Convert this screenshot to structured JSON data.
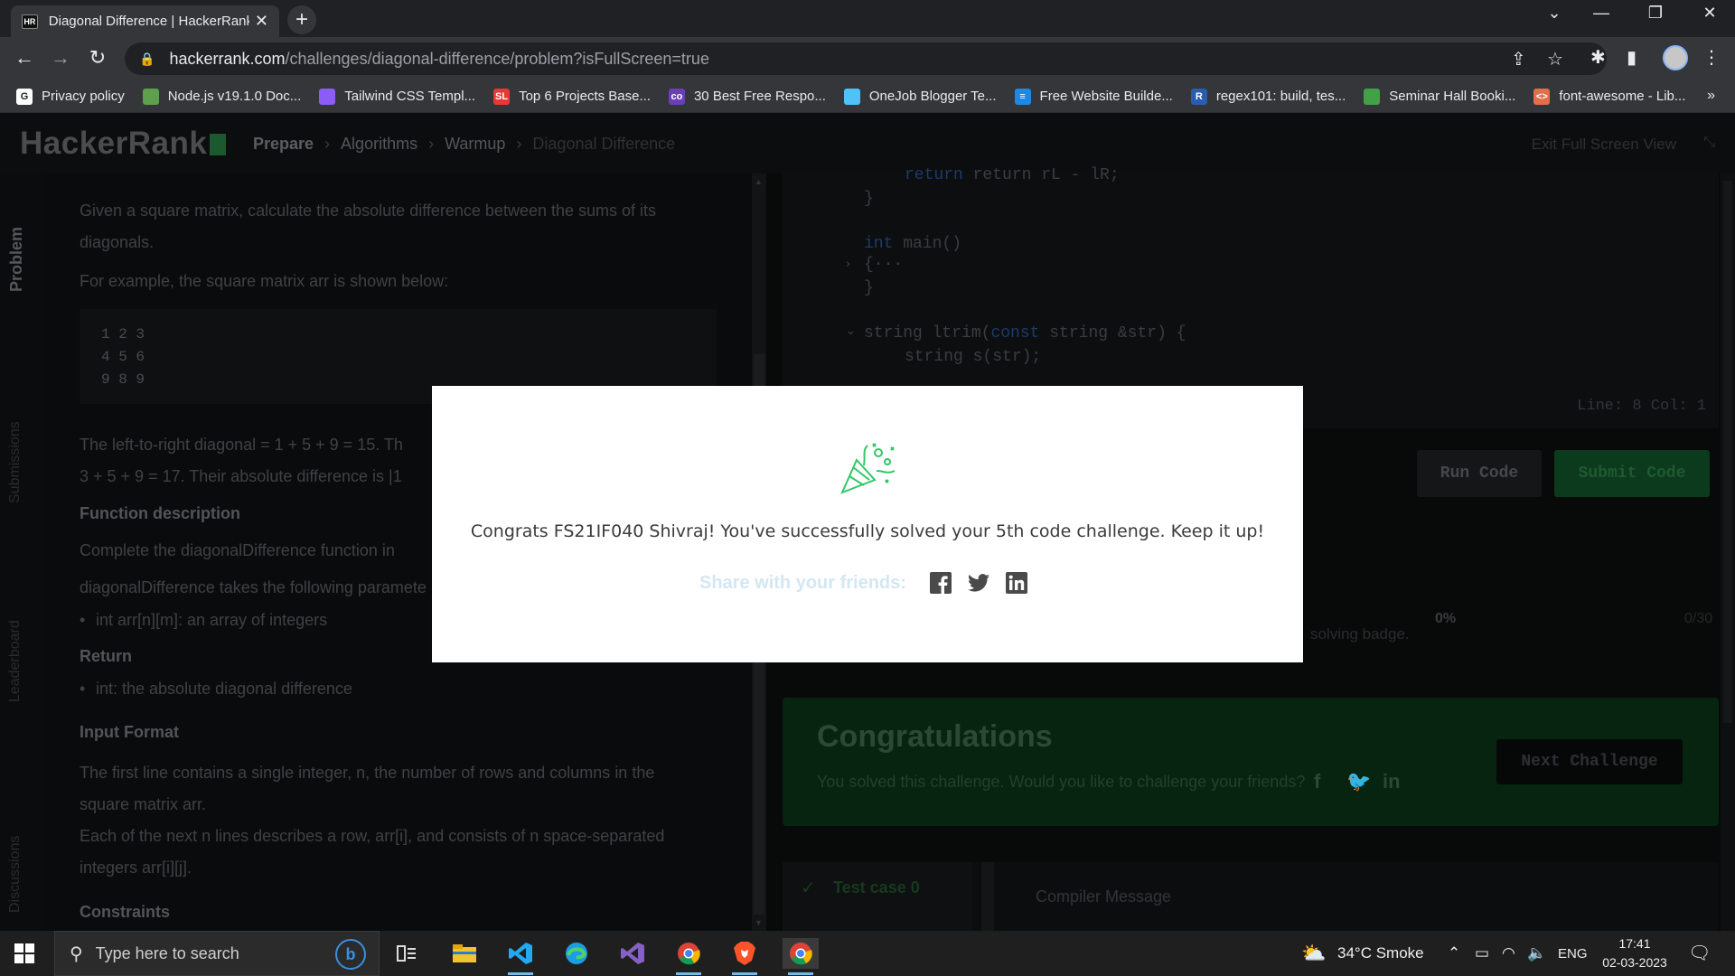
{
  "browser": {
    "tab_title": "Diagonal Difference | HackerRank",
    "tab_favicon": "HR",
    "url_domain": "hackerrank.com",
    "url_path": "/challenges/diagonal-difference/problem?isFullScreen=true",
    "bookmarks": [
      {
        "label": "Privacy policy",
        "icon": "G",
        "color": "#ffffff"
      },
      {
        "label": "Node.js v19.1.0 Doc...",
        "icon": "",
        "color": "#5fa04e"
      },
      {
        "label": "Tailwind CSS Templ...",
        "icon": "",
        "color": "#8b5cf6"
      },
      {
        "label": "Top 6 Projects Base...",
        "icon": "SL",
        "color": "#e53935"
      },
      {
        "label": "30 Best Free Respo...",
        "icon": "co",
        "color": "#6a3fb5"
      },
      {
        "label": "OneJob Blogger Te...",
        "icon": "",
        "color": "#4fc3f7"
      },
      {
        "label": "Free Website Builde...",
        "icon": "≡",
        "color": "#1e88e5"
      },
      {
        "label": "regex101: build, tes...",
        "icon": "R",
        "color": "#2a5db0"
      },
      {
        "label": "Seminar Hall Booki...",
        "icon": "",
        "color": "#43a047"
      },
      {
        "label": "font-awesome - Lib...",
        "icon": "<>",
        "color": "#e0704b"
      }
    ],
    "bookmarks_more": "»"
  },
  "hr": {
    "logo": "HackerRank",
    "breadcrumbs": [
      "Prepare",
      "Algorithms",
      "Warmup",
      "Diagonal Difference"
    ],
    "exit_fullscreen": "Exit Full Screen View",
    "side_tabs": [
      "Problem",
      "Submissions",
      "Leaderboard",
      "Discussions"
    ],
    "problem": {
      "intro_1": "Given a square matrix, calculate the absolute difference between the sums of its",
      "intro_2": "diagonals.",
      "example": "For example, the square matrix arr is shown below:",
      "matrix": "1 2 3\n4 5 6\n9 8 9",
      "ltr": "The left-to-right diagonal = 1 + 5 + 9 = 15. Th",
      "rtl": "3 + 5 + 9 = 17. Their absolute difference is |1",
      "h_func": "Function description",
      "func_1": "Complete the diagonalDifference function in",
      "func_2": "diagonalDifference takes the following paramete",
      "func_bullet": "int arr[n][m]: an array of integers",
      "h_return": "Return",
      "return_bullet": "int: the absolute diagonal difference",
      "h_input": "Input Format",
      "input_1": "The first line contains a single integer, n, the number of rows and columns in the",
      "input_2": "square matrix arr.",
      "input_3": "Each of the next n lines describes a row, arr[i], and consists of n space-separated",
      "input_4": "integers arr[i][j].",
      "h_constraints": "Constraints"
    },
    "code_lines": [
      "return rL - lR;",
      "}",
      "int main()",
      "{···",
      "}",
      "string ltrim(const string &str) {",
      "string s(str);"
    ],
    "line_col": "Line: 8 Col: 1",
    "run_code": "Run Code",
    "submit_code": "Submit Code",
    "badge_text": "solving badge.",
    "progress_pct": "0%",
    "progress_frac": "0/30",
    "congrats_title": "Congratulations",
    "congrats_sub": "You solved this challenge. Would you like to challenge your friends?",
    "next_challenge": "Next Challenge",
    "test_case": "Test case 0",
    "compiler_message": "Compiler Message"
  },
  "modal": {
    "message": "Congrats FS21IF040 Shivraj! You've successfully solved your 5th code challenge. Keep it up!",
    "share_label": "Share with your friends:",
    "icons": [
      "facebook-icon",
      "twitter-icon",
      "linkedin-icon"
    ],
    "accent": "#2ec866"
  },
  "taskbar": {
    "search_placeholder": "Type here to search",
    "weather": "34°C  Smoke",
    "lang": "ENG",
    "time": "17:41",
    "date": "02-03-2023"
  }
}
